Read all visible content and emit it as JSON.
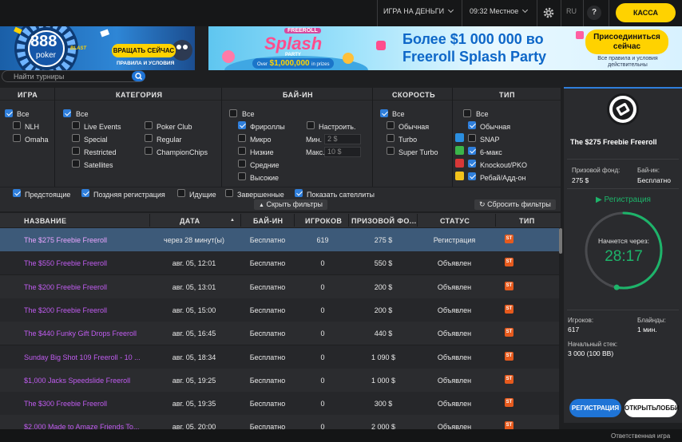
{
  "top": {
    "play_money": "ИГРА НА ДЕНЬГИ",
    "time": "09:32 Местное",
    "lang": "RU",
    "help": "?",
    "cashier": "КАССА"
  },
  "ad1": {
    "brand_num": "888",
    "brand_word": "poker",
    "blast": "BLAST",
    "cta": "ВРАЩАТЬ СЕЙЧАС",
    "terms": "ПРАВИЛА И УСЛОВИЯ"
  },
  "ad2": {
    "badge": "FREEROLL",
    "title_splash": "Splash",
    "title_party": "PARTY",
    "over": "Over",
    "prize": "$1,000,000",
    "in_prizes": "in prizes",
    "headline1": "Более $1 000 000 во",
    "headline2": "Freeroll Splash Party",
    "cta1": "Присоединиться",
    "cta2": "сейчас",
    "terms": "Все правила и условия действительны"
  },
  "search": {
    "placeholder": "Найти турниры"
  },
  "filters": {
    "headers": {
      "game": "ИГРА",
      "category": "КАТЕГОРИЯ",
      "buyin": "БАЙ-ИН",
      "speed": "СКОРОСТЬ",
      "type": "ТИП"
    },
    "game": {
      "all": "Все",
      "nlh": "NLH",
      "omaha": "Omaha"
    },
    "category": {
      "all": "Все",
      "live": "Live Events",
      "special": "Special",
      "restricted": "Restricted",
      "satellites": "Satellites",
      "pokerclub": "Poker Club",
      "regular": "Regular",
      "championchips": "ChampionChips"
    },
    "buyin": {
      "all": "Все",
      "freerolls": "Фрироллы",
      "micro": "Микро",
      "low": "Низкие",
      "medium": "Средние",
      "high": "Высокие",
      "custom": "Настроить.",
      "min_label": "Мин.",
      "min_value": "2 $",
      "max_label": "Макс.",
      "max_value": "10 $"
    },
    "speed": {
      "all": "Все",
      "normal": "Обычная",
      "turbo": "Turbo",
      "superturbo": "Super Turbo"
    },
    "type": {
      "all": "Все",
      "normal": "Обычная",
      "snap": "SNAP",
      "sixmax": "6-макс",
      "knockout": "Knockout/PKO",
      "rebuy": "Ребай/Адд-он"
    },
    "bottom": {
      "upcoming": "Предстоящие",
      "late": "Поздняя регистрация",
      "running": "Идущие",
      "completed": "Завершенные",
      "satellites": "Показать сателлиты"
    },
    "hide": "Скрыть фильтры",
    "reset": "Сбросить фильтры"
  },
  "table": {
    "columns": {
      "name": "НАЗВАНИЕ",
      "date": "ДАТА",
      "buyin": "БАЙ-ИН",
      "players": "ИГРОКОВ",
      "prize": "ПРИЗОВОЙ ФО...",
      "status": "СТАТУС",
      "type": "ТИП"
    },
    "rows": [
      {
        "name": "The $275 Freebie Freeroll",
        "date": "через 28 минут(ы)",
        "buyin": "Бесплатно",
        "players": "619",
        "prize": "275 $",
        "status": "Регистрация",
        "type": "ST"
      },
      {
        "name": "The $550 Freebie Freeroll",
        "date": "авг. 05, 12:01",
        "buyin": "Бесплатно",
        "players": "0",
        "prize": "550 $",
        "status": "Объявлен",
        "type": "ST"
      },
      {
        "name": "The $200 Freebie Freeroll",
        "date": "авг. 05, 13:01",
        "buyin": "Бесплатно",
        "players": "0",
        "prize": "200 $",
        "status": "Объявлен",
        "type": "ST"
      },
      {
        "name": "The $200 Freebie Freeroll",
        "date": "авг. 05, 15:00",
        "buyin": "Бесплатно",
        "players": "0",
        "prize": "200 $",
        "status": "Объявлен",
        "type": "ST"
      },
      {
        "name": "The $440 Funky Gift Drops Freeroll",
        "date": "авг. 05, 16:45",
        "buyin": "Бесплатно",
        "players": "0",
        "prize": "440 $",
        "status": "Объявлен",
        "type": "ST"
      },
      {
        "name": "Sunday Big Shot 109 Freeroll - 10 ...",
        "date": "авг. 05, 18:34",
        "buyin": "Бесплатно",
        "players": "0",
        "prize": "1 090 $",
        "status": "Объявлен",
        "type": "ST"
      },
      {
        "name": "$1,000 Jacks Speedslide Freeroll",
        "date": "авг. 05, 19:25",
        "buyin": "Бесплатно",
        "players": "0",
        "prize": "1 000 $",
        "status": "Объявлен",
        "type": "ST"
      },
      {
        "name": "The $300 Freebie Freeroll",
        "date": "авг. 05, 19:35",
        "buyin": "Бесплатно",
        "players": "0",
        "prize": "300 $",
        "status": "Объявлен",
        "type": "ST"
      },
      {
        "name": "$2,000 Made to Amaze Friends To...",
        "date": "авг. 05, 20:00",
        "buyin": "Бесплатно",
        "players": "0",
        "prize": "2 000 $",
        "status": "Объявлен",
        "type": "ST"
      }
    ]
  },
  "panel": {
    "title": "The $275 Freebie Freeroll",
    "prize_label": "Призовой фонд:",
    "prize_value": "275 $",
    "buyin_label": "Бай-ин:",
    "buyin_value": "Бесплатно",
    "reg_status": "Регистрация",
    "starts_label": "Начнется через:",
    "countdown": "28:17",
    "countdown_progress": 0.53,
    "players_label": "Игроков:",
    "players_value": "617",
    "blinds_label": "Блайнды:",
    "blinds_value": "1 мин.",
    "stack_label": "Начальный стек:",
    "stack_value": "3 000 (100 BB)",
    "register_btn": "РЕГИСТРАЦИЯ",
    "lobby_btn": "ОТКРЫТЬЛОББИ"
  },
  "footer": {
    "responsible": "Ответственная игра"
  },
  "colors": {
    "accent": "#2f7fdc",
    "brand_yellow": "#ffd200",
    "name_purple": "#c05cf0",
    "selected_row": "#3d5a79",
    "ring_green": "#1db46a"
  }
}
